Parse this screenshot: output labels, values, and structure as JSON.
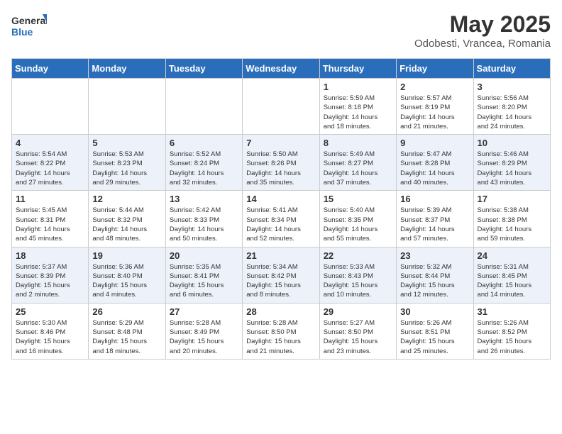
{
  "header": {
    "logo_line1": "General",
    "logo_line2": "Blue",
    "title": "May 2025",
    "subtitle": "Odobesti, Vrancea, Romania"
  },
  "weekdays": [
    "Sunday",
    "Monday",
    "Tuesday",
    "Wednesday",
    "Thursday",
    "Friday",
    "Saturday"
  ],
  "weeks": [
    [
      {
        "day": "",
        "info": ""
      },
      {
        "day": "",
        "info": ""
      },
      {
        "day": "",
        "info": ""
      },
      {
        "day": "",
        "info": ""
      },
      {
        "day": "1",
        "info": "Sunrise: 5:59 AM\nSunset: 8:18 PM\nDaylight: 14 hours\nand 18 minutes."
      },
      {
        "day": "2",
        "info": "Sunrise: 5:57 AM\nSunset: 8:19 PM\nDaylight: 14 hours\nand 21 minutes."
      },
      {
        "day": "3",
        "info": "Sunrise: 5:56 AM\nSunset: 8:20 PM\nDaylight: 14 hours\nand 24 minutes."
      }
    ],
    [
      {
        "day": "4",
        "info": "Sunrise: 5:54 AM\nSunset: 8:22 PM\nDaylight: 14 hours\nand 27 minutes."
      },
      {
        "day": "5",
        "info": "Sunrise: 5:53 AM\nSunset: 8:23 PM\nDaylight: 14 hours\nand 29 minutes."
      },
      {
        "day": "6",
        "info": "Sunrise: 5:52 AM\nSunset: 8:24 PM\nDaylight: 14 hours\nand 32 minutes."
      },
      {
        "day": "7",
        "info": "Sunrise: 5:50 AM\nSunset: 8:26 PM\nDaylight: 14 hours\nand 35 minutes."
      },
      {
        "day": "8",
        "info": "Sunrise: 5:49 AM\nSunset: 8:27 PM\nDaylight: 14 hours\nand 37 minutes."
      },
      {
        "day": "9",
        "info": "Sunrise: 5:47 AM\nSunset: 8:28 PM\nDaylight: 14 hours\nand 40 minutes."
      },
      {
        "day": "10",
        "info": "Sunrise: 5:46 AM\nSunset: 8:29 PM\nDaylight: 14 hours\nand 43 minutes."
      }
    ],
    [
      {
        "day": "11",
        "info": "Sunrise: 5:45 AM\nSunset: 8:31 PM\nDaylight: 14 hours\nand 45 minutes."
      },
      {
        "day": "12",
        "info": "Sunrise: 5:44 AM\nSunset: 8:32 PM\nDaylight: 14 hours\nand 48 minutes."
      },
      {
        "day": "13",
        "info": "Sunrise: 5:42 AM\nSunset: 8:33 PM\nDaylight: 14 hours\nand 50 minutes."
      },
      {
        "day": "14",
        "info": "Sunrise: 5:41 AM\nSunset: 8:34 PM\nDaylight: 14 hours\nand 52 minutes."
      },
      {
        "day": "15",
        "info": "Sunrise: 5:40 AM\nSunset: 8:35 PM\nDaylight: 14 hours\nand 55 minutes."
      },
      {
        "day": "16",
        "info": "Sunrise: 5:39 AM\nSunset: 8:37 PM\nDaylight: 14 hours\nand 57 minutes."
      },
      {
        "day": "17",
        "info": "Sunrise: 5:38 AM\nSunset: 8:38 PM\nDaylight: 14 hours\nand 59 minutes."
      }
    ],
    [
      {
        "day": "18",
        "info": "Sunrise: 5:37 AM\nSunset: 8:39 PM\nDaylight: 15 hours\nand 2 minutes."
      },
      {
        "day": "19",
        "info": "Sunrise: 5:36 AM\nSunset: 8:40 PM\nDaylight: 15 hours\nand 4 minutes."
      },
      {
        "day": "20",
        "info": "Sunrise: 5:35 AM\nSunset: 8:41 PM\nDaylight: 15 hours\nand 6 minutes."
      },
      {
        "day": "21",
        "info": "Sunrise: 5:34 AM\nSunset: 8:42 PM\nDaylight: 15 hours\nand 8 minutes."
      },
      {
        "day": "22",
        "info": "Sunrise: 5:33 AM\nSunset: 8:43 PM\nDaylight: 15 hours\nand 10 minutes."
      },
      {
        "day": "23",
        "info": "Sunrise: 5:32 AM\nSunset: 8:44 PM\nDaylight: 15 hours\nand 12 minutes."
      },
      {
        "day": "24",
        "info": "Sunrise: 5:31 AM\nSunset: 8:45 PM\nDaylight: 15 hours\nand 14 minutes."
      }
    ],
    [
      {
        "day": "25",
        "info": "Sunrise: 5:30 AM\nSunset: 8:46 PM\nDaylight: 15 hours\nand 16 minutes."
      },
      {
        "day": "26",
        "info": "Sunrise: 5:29 AM\nSunset: 8:48 PM\nDaylight: 15 hours\nand 18 minutes."
      },
      {
        "day": "27",
        "info": "Sunrise: 5:28 AM\nSunset: 8:49 PM\nDaylight: 15 hours\nand 20 minutes."
      },
      {
        "day": "28",
        "info": "Sunrise: 5:28 AM\nSunset: 8:50 PM\nDaylight: 15 hours\nand 21 minutes."
      },
      {
        "day": "29",
        "info": "Sunrise: 5:27 AM\nSunset: 8:50 PM\nDaylight: 15 hours\nand 23 minutes."
      },
      {
        "day": "30",
        "info": "Sunrise: 5:26 AM\nSunset: 8:51 PM\nDaylight: 15 hours\nand 25 minutes."
      },
      {
        "day": "31",
        "info": "Sunrise: 5:26 AM\nSunset: 8:52 PM\nDaylight: 15 hours\nand 26 minutes."
      }
    ]
  ]
}
